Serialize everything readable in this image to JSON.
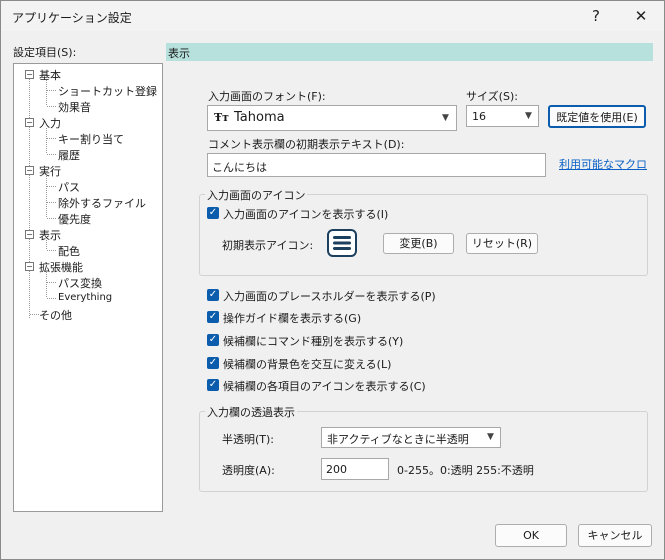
{
  "window": {
    "title": "アプリケーション設定",
    "help_label": "?",
    "close_label": "✕"
  },
  "tree": {
    "header_label": "設定項目(S):",
    "items": [
      {
        "label": "基本",
        "children": [
          "ショートカット登録",
          "効果音"
        ]
      },
      {
        "label": "入力",
        "children": [
          "キー割り当て",
          "履歴"
        ]
      },
      {
        "label": "実行",
        "children": [
          "パス",
          "除外するファイル",
          "優先度"
        ]
      },
      {
        "label": "表示",
        "children": [
          "配色"
        ]
      },
      {
        "label": "拡張機能",
        "children": [
          "パス変換",
          "Everything"
        ]
      },
      {
        "label": "その他",
        "children": []
      }
    ]
  },
  "section": {
    "title": "表示"
  },
  "font": {
    "label": "入力画面のフォント(F):",
    "value": "Tahoma",
    "icon": "font-type-icon"
  },
  "size": {
    "label": "サイズ(S):",
    "value": "16"
  },
  "default_button": "既定値を使用(E)",
  "comment": {
    "label": "コメント表示欄の初期表示テキスト(D):",
    "value": "こんにちは"
  },
  "macro_link": "利用可能なマクロ",
  "icon_group": {
    "title": "入力画面のアイコン",
    "show_icon_label": "入力画面のアイコンを表示する(I)",
    "show_icon_checked": true,
    "initial_icon_label": "初期表示アイコン:",
    "change_button": "変更(B)",
    "reset_button": "リセット(R)"
  },
  "options": [
    {
      "label": "入力画面のプレースホルダーを表示する(P)",
      "checked": true
    },
    {
      "label": "操作ガイド欄を表示する(G)",
      "checked": true
    },
    {
      "label": "候補欄にコマンド種別を表示する(Y)",
      "checked": true
    },
    {
      "label": "候補欄の背景色を交互に変える(L)",
      "checked": true
    },
    {
      "label": "候補欄の各項目のアイコンを表示する(C)",
      "checked": true
    }
  ],
  "transparency": {
    "title": "入力欄の透過表示",
    "mode_label": "半透明(T):",
    "mode_value": "非アクティブなときに半透明",
    "level_label": "透明度(A):",
    "level_value": "200",
    "hint": "0-255。0:透明 255:不透明"
  },
  "footer": {
    "ok": "OK",
    "cancel": "キャンセル"
  }
}
